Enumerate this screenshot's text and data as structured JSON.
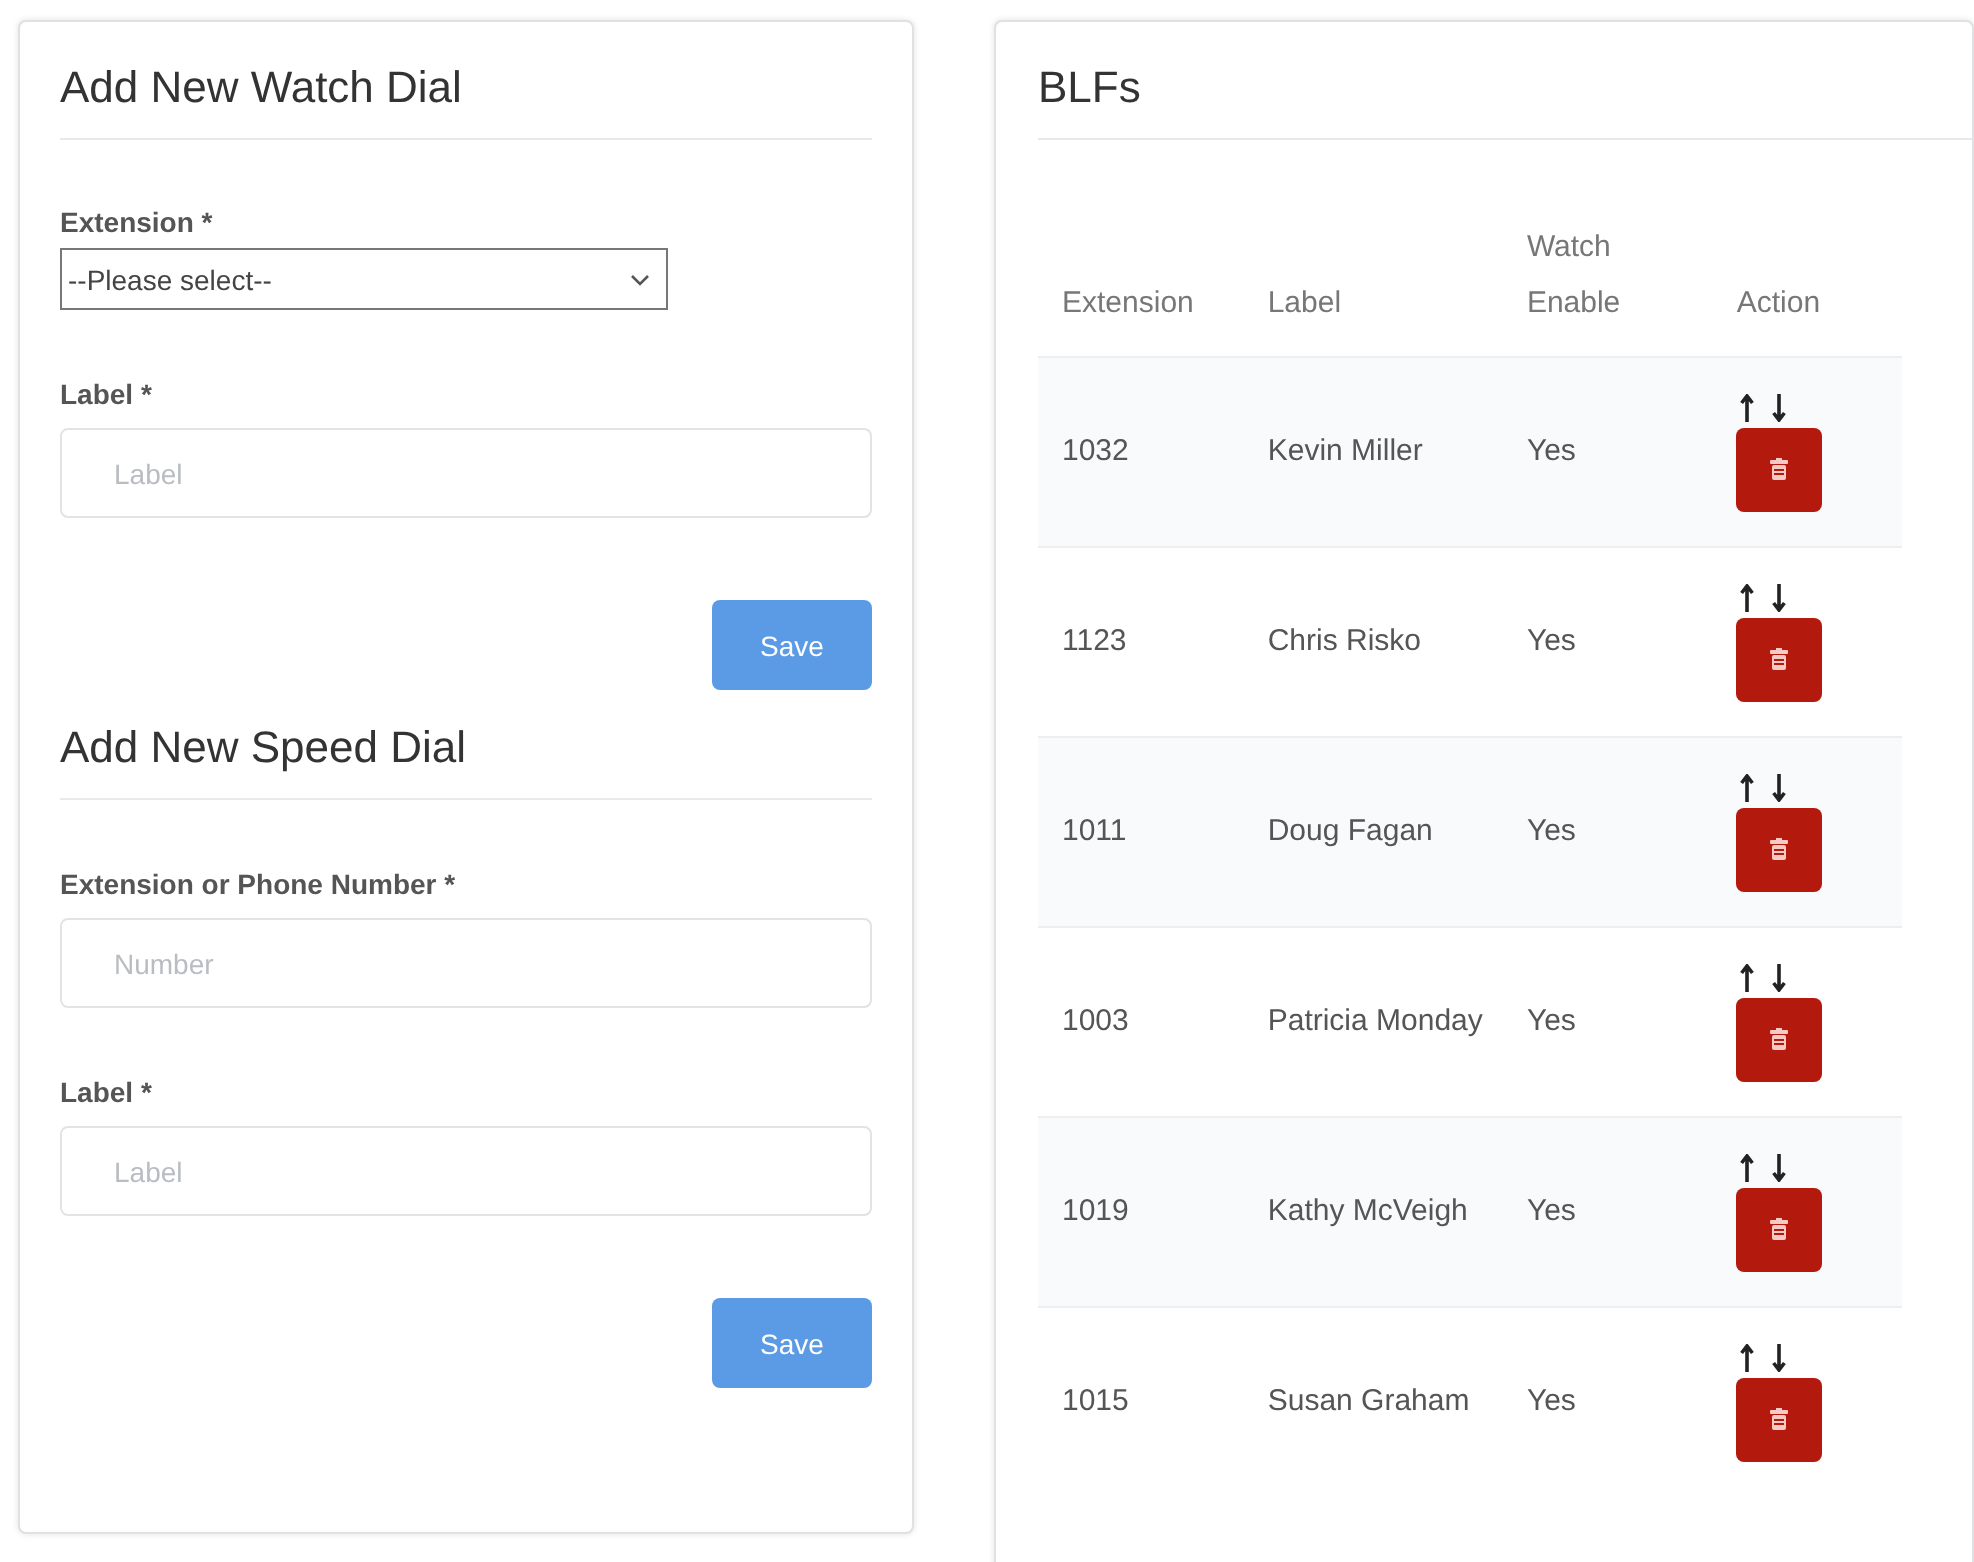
{
  "watch_dial": {
    "title": "Add New Watch Dial",
    "fields": [
      {
        "kind": "select",
        "label": "Extension *",
        "value": "--Please select--"
      },
      {
        "kind": "text",
        "label": "Label *",
        "placeholder": "Label"
      }
    ],
    "button": "Save"
  },
  "speed_dial": {
    "title": "Add New Speed Dial",
    "fields": [
      {
        "kind": "text",
        "label": "Extension or Phone Number *",
        "placeholder": "Number"
      },
      {
        "kind": "text",
        "label": "Label *",
        "placeholder": "Label"
      }
    ],
    "button": "Save"
  },
  "blfs": {
    "title": "BLFs",
    "columns": [
      "Extension",
      "Label",
      "Watch Enable",
      "Action"
    ],
    "rows": [
      {
        "extension": "1032",
        "label": "Kevin Miller",
        "watch_enable": "Yes"
      },
      {
        "extension": "1123",
        "label": "Chris Risko",
        "watch_enable": "Yes"
      },
      {
        "extension": "1011",
        "label": "Doug Fagan",
        "watch_enable": "Yes"
      },
      {
        "extension": "1003",
        "label": "Patricia Monday",
        "watch_enable": "Yes"
      },
      {
        "extension": "1019",
        "label": "Kathy McVeigh",
        "watch_enable": "Yes"
      },
      {
        "extension": "1015",
        "label": "Susan Graham",
        "watch_enable": "Yes"
      }
    ]
  }
}
